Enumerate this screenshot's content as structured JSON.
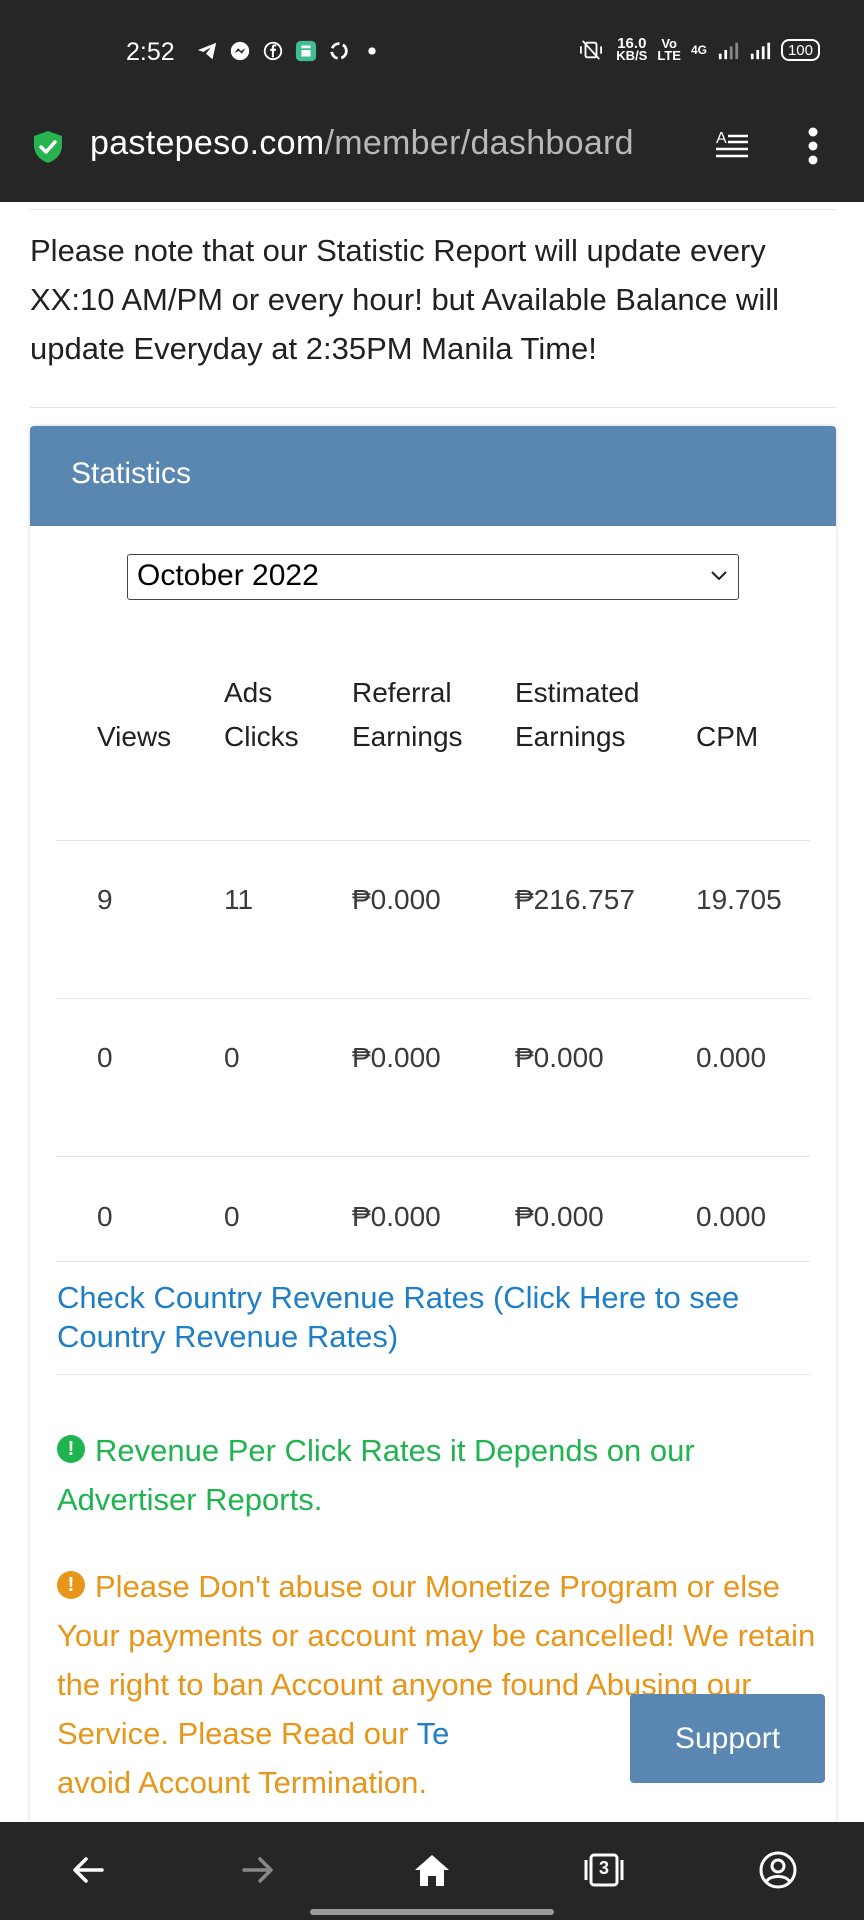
{
  "status_bar": {
    "time": "2:52",
    "net_speed_value": "16.0",
    "net_speed_unit": "KB/S",
    "volte_top": "Vo",
    "volte_bottom": "LTE",
    "network_type": "4G",
    "battery": "100"
  },
  "browser": {
    "url_domain": "pastepeso.com",
    "url_path": "/member/dashboard"
  },
  "notice_text": "Please note that our Statistic Report will update every XX:10 AM/PM or every hour! but Available Balance will update Everyday at 2:35PM Manila Time!",
  "statistics": {
    "title": "Statistics",
    "selected_month": "October 2022",
    "headers": {
      "views": "Views",
      "ads_clicks_1": "Ads",
      "ads_clicks_2": "Clicks",
      "referral_1": "Referral",
      "referral_2": "Earnings",
      "estimated_1": "Estimated",
      "estimated_2": "Earnings",
      "cpm": "CPM"
    },
    "rows": [
      {
        "views": "9",
        "clicks": "11",
        "referral": "₱0.000",
        "estimated": "₱216.757",
        "cpm": "19.705"
      },
      {
        "views": "0",
        "clicks": "0",
        "referral": "₱0.000",
        "estimated": "₱0.000",
        "cpm": "0.000"
      },
      {
        "views": "0",
        "clicks": "0",
        "referral": "₱0.000",
        "estimated": "₱0.000",
        "cpm": "0.000"
      }
    ],
    "country_rates_link": "Check Country Revenue Rates (Click Here to see Country Revenue Rates)",
    "rpc_notice": "Revenue Per Click Rates it Depends on our Advertiser Reports.",
    "warning_before_link": "Please Don't abuse our Monetize Program or else Your payments or account may be cancelled! We retain the right to ban Account anyone found Abusing our Service. Please Read our ",
    "warning_link": "Te",
    "warning_after_link": "avoid Account Termination."
  },
  "support_button": "Support",
  "tab_count": "3",
  "colors": {
    "header_blue": "#5987b1",
    "link_blue": "#1f7fc6",
    "success_green": "#1fb44f",
    "warning_orange": "#e8961a",
    "browser_chrome": "#262626"
  }
}
